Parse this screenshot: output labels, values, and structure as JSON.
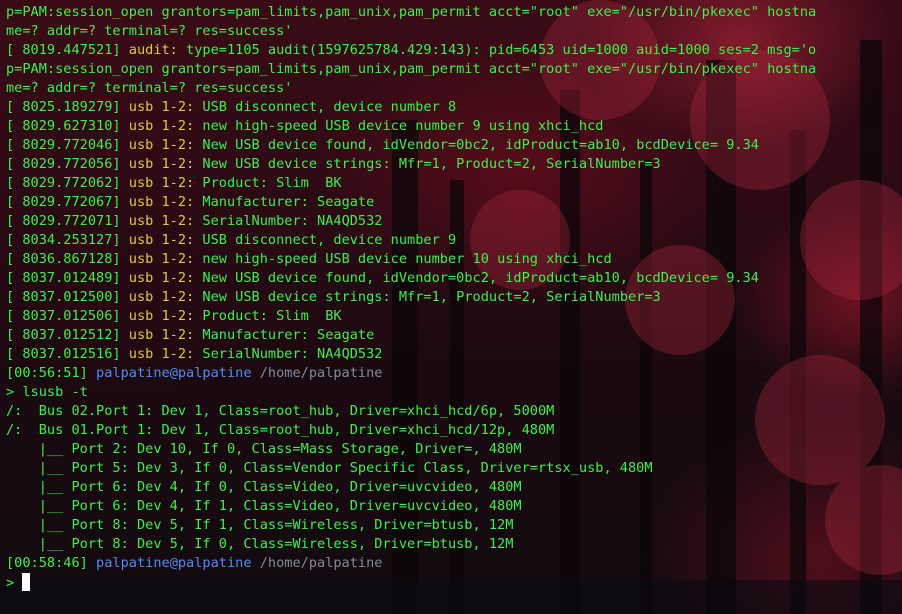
{
  "terminal": {
    "lines": [
      {
        "kind": "plain",
        "text": "p=PAM:session_open grantors=pam_limits,pam_unix,pam_permit acct=\"root\" exe=\"/usr/bin/pkexec\" hostna"
      },
      {
        "kind": "plain",
        "text": "me=? addr=? terminal=? res=success'"
      },
      {
        "kind": "log",
        "ts": "[ 8019.447521]",
        "src": "audit:",
        "msg": " type=1105 audit(1597625784.429:143): pid=6453 uid=1000 auid=1000 ses=2 msg='o"
      },
      {
        "kind": "plain",
        "text": "p=PAM:session_open grantors=pam_limits,pam_unix,pam_permit acct=\"root\" exe=\"/usr/bin/pkexec\" hostna"
      },
      {
        "kind": "plain",
        "text": "me=? addr=? terminal=? res=success'"
      },
      {
        "kind": "log",
        "ts": "[ 8025.189279]",
        "src": "usb 1-2:",
        "msg": " USB disconnect, device number 8"
      },
      {
        "kind": "log",
        "ts": "[ 8029.627310]",
        "src": "usb 1-2:",
        "msg": " new high-speed USB device number 9 using xhci_hcd"
      },
      {
        "kind": "log",
        "ts": "[ 8029.772046]",
        "src": "usb 1-2:",
        "msg": " New USB device found, idVendor=0bc2, idProduct=ab10, bcdDevice= 9.34"
      },
      {
        "kind": "log",
        "ts": "[ 8029.772056]",
        "src": "usb 1-2:",
        "msg": " New USB device strings: Mfr=1, Product=2, SerialNumber=3"
      },
      {
        "kind": "log",
        "ts": "[ 8029.772062]",
        "src": "usb 1-2:",
        "msg": " Product: Slim  BK"
      },
      {
        "kind": "log",
        "ts": "[ 8029.772067]",
        "src": "usb 1-2:",
        "msg": " Manufacturer: Seagate"
      },
      {
        "kind": "log",
        "ts": "[ 8029.772071]",
        "src": "usb 1-2:",
        "msg": " SerialNumber: NA4QD532"
      },
      {
        "kind": "log",
        "ts": "[ 8034.253127]",
        "src": "usb 1-2:",
        "msg": " USB disconnect, device number 9"
      },
      {
        "kind": "log",
        "ts": "[ 8036.867128]",
        "src": "usb 1-2:",
        "msg": " new high-speed USB device number 10 using xhci_hcd"
      },
      {
        "kind": "log",
        "ts": "[ 8037.012489]",
        "src": "usb 1-2:",
        "msg": " New USB device found, idVendor=0bc2, idProduct=ab10, bcdDevice= 9.34"
      },
      {
        "kind": "log",
        "ts": "[ 8037.012500]",
        "src": "usb 1-2:",
        "msg": " New USB device strings: Mfr=1, Product=2, SerialNumber=3"
      },
      {
        "kind": "log",
        "ts": "[ 8037.012506]",
        "src": "usb 1-2:",
        "msg": " Product: Slim  BK"
      },
      {
        "kind": "log",
        "ts": "[ 8037.012512]",
        "src": "usb 1-2:",
        "msg": " Manufacturer: Seagate"
      },
      {
        "kind": "log",
        "ts": "[ 8037.012516]",
        "src": "usb 1-2:",
        "msg": " SerialNumber: NA4QD532"
      },
      {
        "kind": "prompt",
        "time": "[00:56:51]",
        "user": "palpatine@palpatine",
        "path": "/home/palpatine"
      },
      {
        "kind": "command",
        "text": "> lsusb -t"
      },
      {
        "kind": "plain",
        "text": "/:  Bus 02.Port 1: Dev 1, Class=root_hub, Driver=xhci_hcd/6p, 5000M"
      },
      {
        "kind": "plain",
        "text": "/:  Bus 01.Port 1: Dev 1, Class=root_hub, Driver=xhci_hcd/12p, 480M"
      },
      {
        "kind": "plain",
        "text": "    |__ Port 2: Dev 10, If 0, Class=Mass Storage, Driver=, 480M"
      },
      {
        "kind": "plain",
        "text": "    |__ Port 5: Dev 3, If 0, Class=Vendor Specific Class, Driver=rtsx_usb, 480M"
      },
      {
        "kind": "plain",
        "text": "    |__ Port 6: Dev 4, If 0, Class=Video, Driver=uvcvideo, 480M"
      },
      {
        "kind": "plain",
        "text": "    |__ Port 6: Dev 4, If 1, Class=Video, Driver=uvcvideo, 480M"
      },
      {
        "kind": "plain",
        "text": "    |__ Port 8: Dev 5, If 1, Class=Wireless, Driver=btusb, 12M"
      },
      {
        "kind": "plain",
        "text": "    |__ Port 8: Dev 5, If 0, Class=Wireless, Driver=btusb, 12M"
      },
      {
        "kind": "prompt",
        "time": "[00:58:46]",
        "user": "palpatine@palpatine",
        "path": "/home/palpatine"
      },
      {
        "kind": "input",
        "text": ">"
      }
    ]
  },
  "colors": {
    "text_green": "#3ef04a",
    "source_yellow": "#e2c93a",
    "user_blue": "#4f8df0",
    "path_gray": "#7d8aa0",
    "background": "#2b0a14"
  }
}
